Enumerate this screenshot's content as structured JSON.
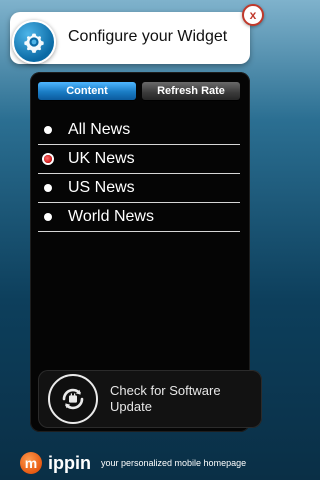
{
  "header": {
    "title": "Configure your Widget",
    "close_label": "x"
  },
  "tabs": {
    "content": "Content",
    "refresh_rate": "Refresh Rate"
  },
  "news_items": [
    {
      "label": "All News",
      "selected": false
    },
    {
      "label": "UK News",
      "selected": true
    },
    {
      "label": "US News",
      "selected": false
    },
    {
      "label": "World News",
      "selected": false
    }
  ],
  "update": {
    "label": "Check for Software Update",
    "icon": "update-icon"
  },
  "footer": {
    "logo_mark": "m",
    "brand": "ippin",
    "tagline": "your personalized mobile homepage"
  },
  "colors": {
    "accent_blue": "#1a7cc4",
    "selected_radio": "#d01a1a",
    "logo_orange": "#e65a12"
  }
}
